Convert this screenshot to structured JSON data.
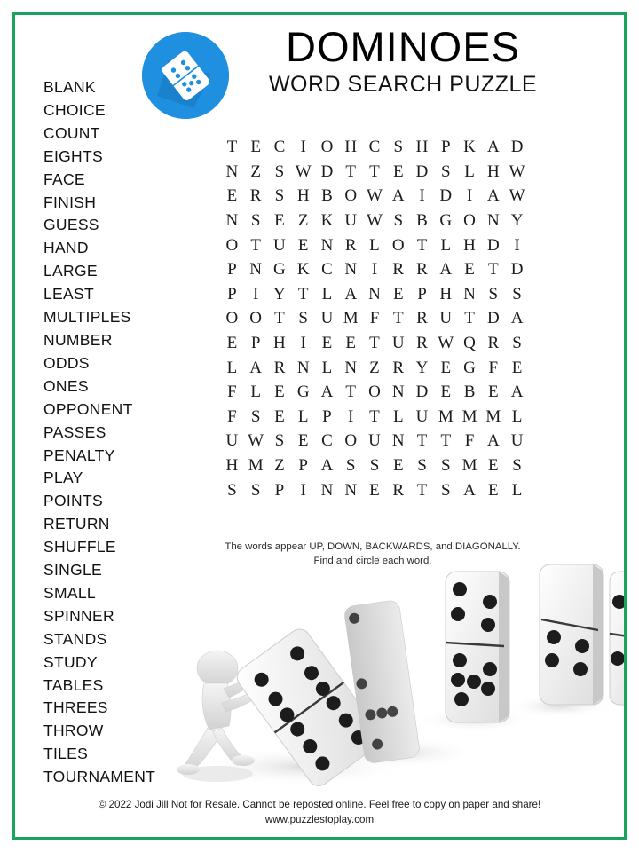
{
  "page": {
    "border_color": "#1aa35c",
    "background": "#ffffff"
  },
  "header": {
    "title": "DOMINOES",
    "subtitle": "WORD SEARCH PUZZLE",
    "logo_icon": "domino-tile-icon",
    "logo_color": "#1f8fe0"
  },
  "word_list": {
    "words": [
      "BLANK",
      "CHOICE",
      "COUNT",
      "EIGHTS",
      "FACE",
      "FINISH",
      "GUESS",
      "HAND",
      "LARGE",
      "LEAST",
      "MULTIPLES",
      "NUMBER",
      "ODDS",
      "ONES",
      "OPPONENT",
      "PASSES",
      "PENALTY",
      "PLAY",
      "POINTS",
      "RETURN",
      "SHUFFLE",
      "SINGLE",
      "SMALL",
      "SPINNER",
      "STANDS",
      "STUDY",
      "TABLES",
      "THREES",
      "THROW",
      "TILES",
      "TOURNAMENT"
    ]
  },
  "grid": {
    "columns": 13,
    "rows_count": 15,
    "rows": [
      [
        "T",
        "E",
        "C",
        "I",
        "O",
        "H",
        "C",
        "S",
        "H",
        "P",
        "K",
        "A",
        "D"
      ],
      [
        "N",
        "Z",
        "S",
        "W",
        "D",
        "T",
        "T",
        "E",
        "D",
        "S",
        "L",
        "H",
        "W"
      ],
      [
        "E",
        "R",
        "S",
        "H",
        "B",
        "O",
        "W",
        "A",
        "I",
        "D",
        "I",
        "A",
        "W"
      ],
      [
        "N",
        "S",
        "E",
        "Z",
        "K",
        "U",
        "W",
        "S",
        "B",
        "G",
        "O",
        "N",
        "Y"
      ],
      [
        "O",
        "T",
        "U",
        "E",
        "N",
        "R",
        "L",
        "O",
        "T",
        "L",
        "H",
        "D",
        "I"
      ],
      [
        "P",
        "N",
        "G",
        "K",
        "C",
        "N",
        "I",
        "R",
        "R",
        "A",
        "E",
        "T",
        "D"
      ],
      [
        "P",
        "I",
        "Y",
        "T",
        "L",
        "A",
        "N",
        "E",
        "P",
        "H",
        "N",
        "S",
        "S"
      ],
      [
        "O",
        "O",
        "T",
        "S",
        "U",
        "M",
        "F",
        "T",
        "R",
        "U",
        "T",
        "D",
        "A"
      ],
      [
        "E",
        "P",
        "H",
        "I",
        "E",
        "E",
        "T",
        "U",
        "R",
        "W",
        "Q",
        "R",
        "S"
      ],
      [
        "L",
        "A",
        "R",
        "N",
        "L",
        "N",
        "Z",
        "R",
        "Y",
        "E",
        "G",
        "F",
        "E"
      ],
      [
        "F",
        "L",
        "E",
        "G",
        "A",
        "T",
        "O",
        "N",
        "D",
        "E",
        "B",
        "E",
        "A"
      ],
      [
        "F",
        "S",
        "E",
        "L",
        "P",
        "I",
        "T",
        "L",
        "U",
        "M",
        "M",
        "M",
        "L"
      ],
      [
        "U",
        "W",
        "S",
        "E",
        "C",
        "O",
        "U",
        "N",
        "T",
        "T",
        "F",
        "A",
        "U"
      ],
      [
        "H",
        "M",
        "Z",
        "P",
        "A",
        "S",
        "S",
        "E",
        "S",
        "S",
        "M",
        "E",
        "S"
      ],
      [
        "S",
        "S",
        "P",
        "I",
        "N",
        "N",
        "E",
        "R",
        "T",
        "S",
        "A",
        "E",
        "L"
      ]
    ]
  },
  "instructions": {
    "line1": "The words appear UP, DOWN, BACKWARDS, and DIAGONALLY.",
    "line2": "Find and circle each word."
  },
  "illustration": {
    "name": "falling-dominoes-illustration",
    "description": "3D figure pushing a row of dominoes"
  },
  "footer": {
    "copyright": "© 2022  Jodi Jill Not for Resale. Cannot be reposted online. Feel free to copy on paper and share!",
    "url": "www.puzzlestoplay.com"
  }
}
